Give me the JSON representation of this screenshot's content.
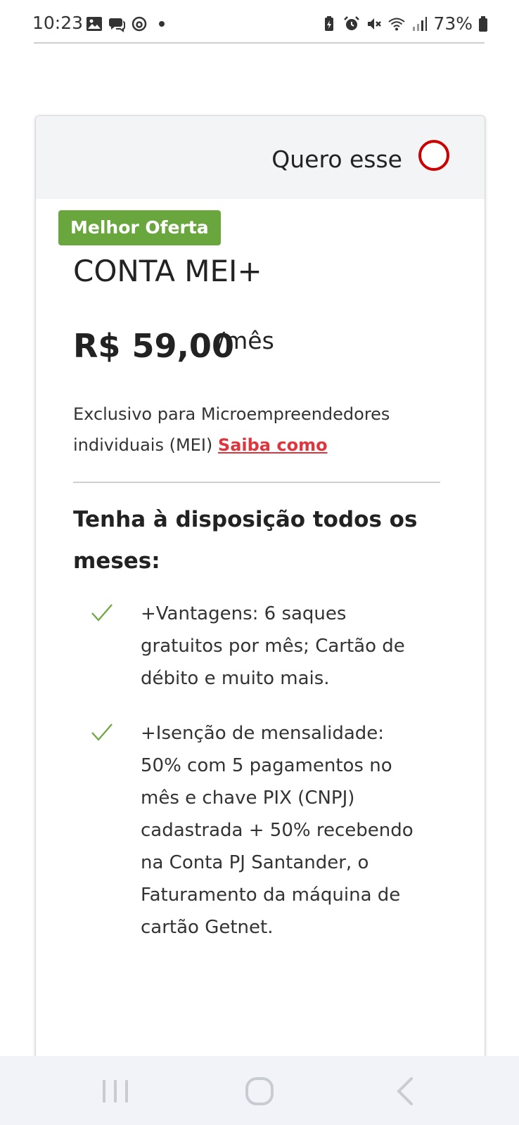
{
  "status_bar": {
    "time": "10:23",
    "left_icons": [
      "image-icon",
      "chat-icon",
      "threads-icon",
      "dot-icon"
    ],
    "right_icons": [
      "battery-saver-icon",
      "alarm-icon",
      "mute-icon",
      "wifi-icon",
      "signal-icon"
    ],
    "battery": "73%"
  },
  "card": {
    "select_label": "Quero esse",
    "badge": "Melhor Oferta",
    "plan_name": "CONTA MEI+",
    "price": "R$ 59,00",
    "price_period": "/mês",
    "description": "Exclusivo para Microempreendedores individuais (MEI)",
    "link": "Saiba como",
    "section_title": "Tenha à disposição todos os meses:",
    "benefits": [
      "+Vantagens: 6 saques gratuitos por mês; Cartão de débito e muito mais.",
      "+Isenção de mensalidade: 50% com 5 pagamentos no mês e chave PIX (CNPJ) cadastrada + 50% recebendo na Conta PJ Santander, o Faturamento da máquina de cartão Getnet."
    ]
  },
  "colors": {
    "accent_red": "#cc0000",
    "link_red": "#e0353d",
    "badge_green": "#6aa63e",
    "check_green": "#6aa63e",
    "header_bg": "#f2f4f6"
  },
  "nav_bar": {
    "buttons": [
      "recent-apps-icon",
      "home-icon",
      "back-icon"
    ]
  }
}
